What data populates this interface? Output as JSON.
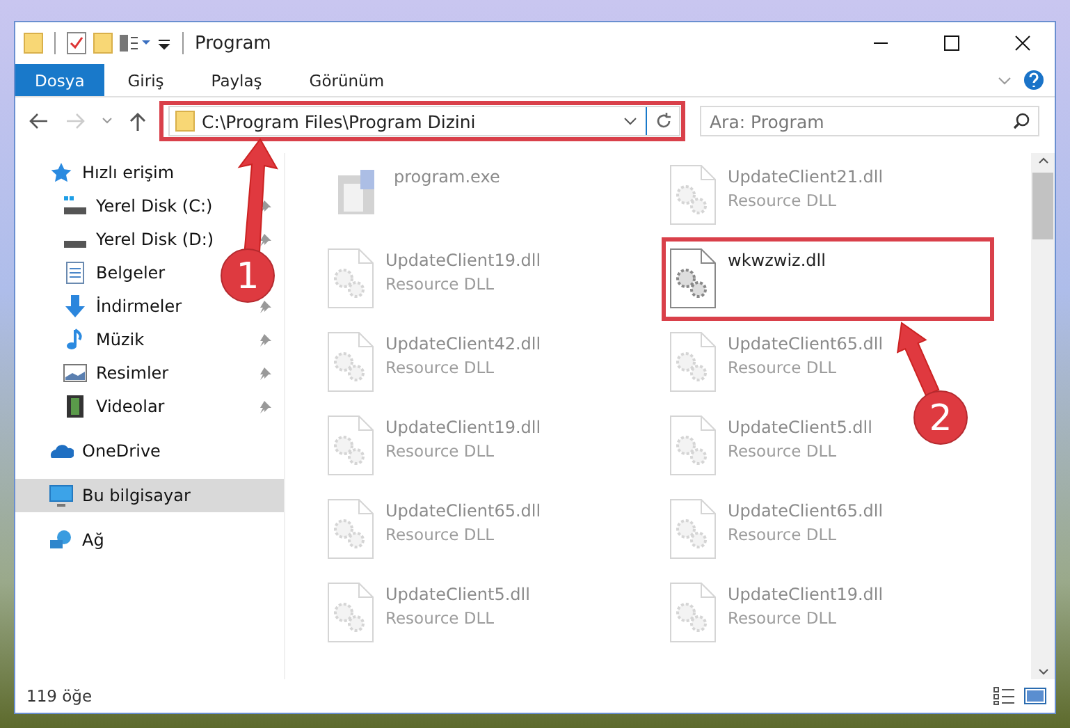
{
  "window": {
    "title": "Program"
  },
  "ribbon_tabs": [
    {
      "label": "Dosya",
      "kind": "file-menu",
      "selected": false
    },
    {
      "label": "Giriş",
      "kind": "tab",
      "selected": false
    },
    {
      "label": "Paylaş",
      "kind": "tab",
      "selected": false
    },
    {
      "label": "Görünüm",
      "kind": "tab",
      "selected": false
    }
  ],
  "address_bar": {
    "path": "C:\\Program Files\\Program Dizini"
  },
  "search": {
    "placeholder": "Ara: Program"
  },
  "sidebar": {
    "items": [
      {
        "label": "Hızlı erişim",
        "kind": "star",
        "selected": false,
        "children": [
          {
            "label": "Yerel Disk (C:)",
            "kind": "system-drive",
            "pinned": true,
            "selected": false
          },
          {
            "label": "Yerel Disk (D:)",
            "kind": "drive",
            "pinned": true,
            "selected": false
          },
          {
            "label": "Belgeler",
            "kind": "documents",
            "pinned": false,
            "selected": false
          },
          {
            "label": "İndirmeler",
            "kind": "download",
            "pinned": true,
            "selected": false
          },
          {
            "label": "Müzik",
            "kind": "music",
            "pinned": true,
            "selected": false
          },
          {
            "label": "Resimler",
            "kind": "pictures",
            "pinned": true,
            "selected": false
          },
          {
            "label": "Videolar",
            "kind": "video",
            "pinned": true,
            "selected": false
          }
        ]
      },
      {
        "label": "OneDrive",
        "kind": "cloud",
        "selected": false
      },
      {
        "label": "Bu bilgisayar",
        "kind": "computer",
        "selected": true
      },
      {
        "label": "Ağ",
        "kind": "network",
        "selected": false
      }
    ]
  },
  "files": [
    {
      "name": "program.exe",
      "kind": "exe",
      "highlighted": false
    },
    {
      "name": "UpdateClient21.dll",
      "type": "Resource DLL",
      "kind": "dll",
      "highlighted": false
    },
    {
      "name": "UpdateClient19.dll",
      "type": "Resource DLL",
      "kind": "dll",
      "highlighted": false
    },
    {
      "name": "wkwzwiz.dll",
      "kind": "dll",
      "highlighted": true
    },
    {
      "name": "UpdateClient42.dll",
      "type": "Resource DLL",
      "kind": "dll",
      "highlighted": false
    },
    {
      "name": "UpdateClient65.dll",
      "type": "Resource DLL",
      "kind": "dll",
      "highlighted": false
    },
    {
      "name": "UpdateClient19.dll",
      "type": "Resource DLL",
      "kind": "dll",
      "highlighted": false
    },
    {
      "name": "UpdateClient5.dll",
      "type": "Resource DLL",
      "kind": "dll",
      "highlighted": false
    },
    {
      "name": "UpdateClient65.dll",
      "type": "Resource DLL",
      "kind": "dll",
      "highlighted": false
    },
    {
      "name": "UpdateClient65.dll",
      "type": "Resource DLL",
      "kind": "dll",
      "highlighted": false
    },
    {
      "name": "UpdateClient5.dll",
      "type": "Resource DLL",
      "kind": "dll",
      "highlighted": false
    },
    {
      "name": "UpdateClient19.dll",
      "type": "Resource DLL",
      "kind": "dll",
      "highlighted": false
    }
  ],
  "status_bar": {
    "count": "119 öğe"
  },
  "callouts": [
    {
      "label": "1"
    },
    {
      "label": "2"
    }
  ]
}
